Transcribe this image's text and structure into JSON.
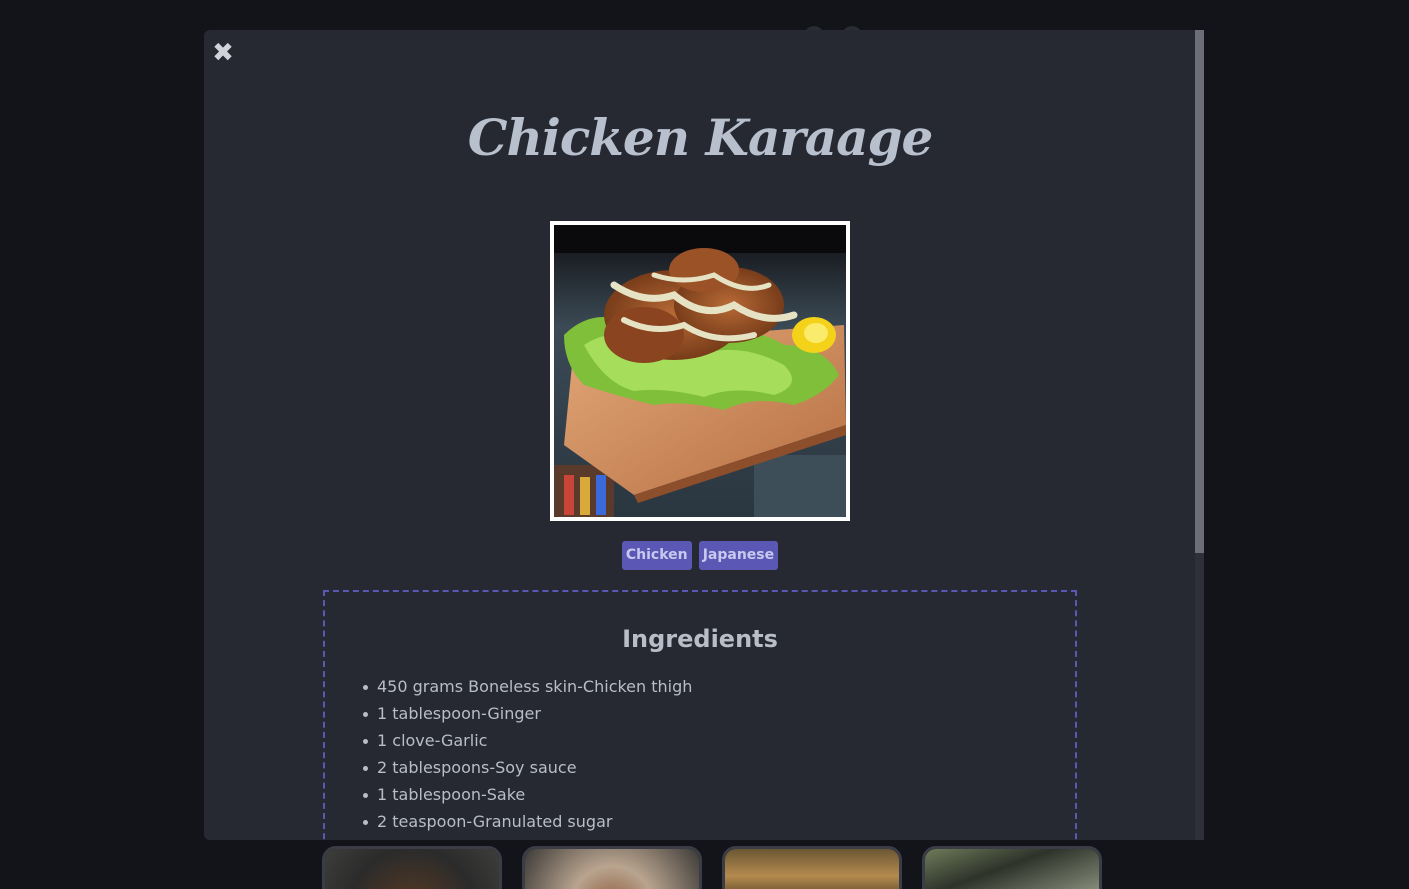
{
  "recipe": {
    "title": "Chicken Karaage",
    "tags": [
      "Chicken",
      "Japanese"
    ],
    "ingredients_heading": "Ingredients",
    "ingredients": [
      "450 grams Boneless skin-Chicken thigh",
      "1 tablespoon-Ginger",
      "1 clove-Garlic",
      "2 tablespoons-Soy sauce",
      "1 tablespoon-Sake",
      "2 teaspoon-Granulated sugar"
    ]
  },
  "modal": {
    "close_icon": "close-icon",
    "close_symbol": "✖"
  },
  "colors": {
    "accent": "#5b58b5",
    "modal_bg": "#262932",
    "page_bg": "#131419"
  }
}
